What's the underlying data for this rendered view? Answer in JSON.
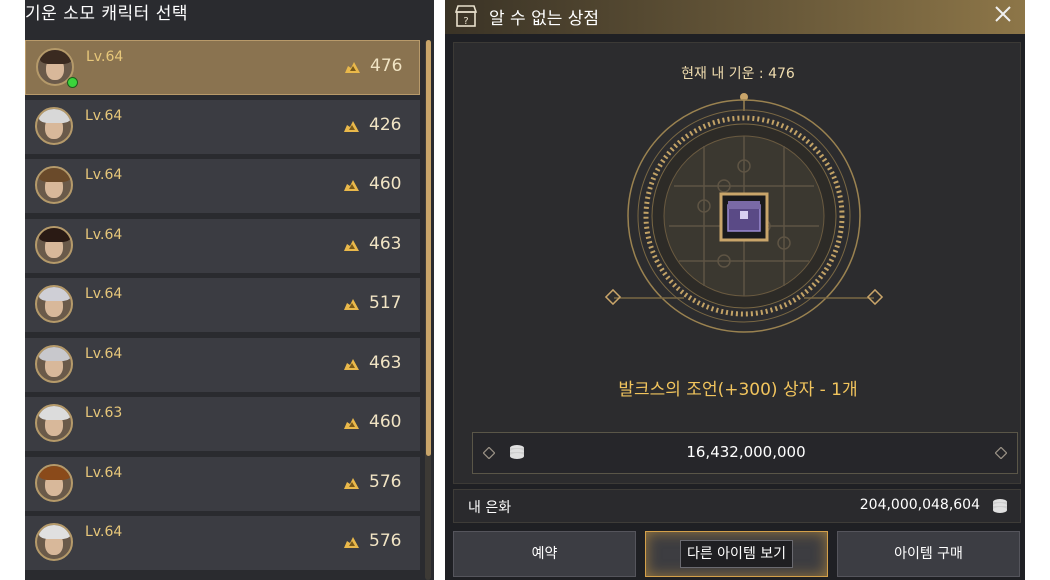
{
  "left_panel": {
    "title": "기운 소모 캐릭터 선택",
    "characters": [
      {
        "level": "Lv.64",
        "points": "476",
        "selected": true,
        "online": true
      },
      {
        "level": "Lv.64",
        "points": "426"
      },
      {
        "level": "Lv.64",
        "points": "460"
      },
      {
        "level": "Lv.64",
        "points": "463"
      },
      {
        "level": "Lv.64",
        "points": "517"
      },
      {
        "level": "Lv.64",
        "points": "463"
      },
      {
        "level": "Lv.63",
        "points": "460"
      },
      {
        "level": "Lv.64",
        "points": "576"
      },
      {
        "level": "Lv.64",
        "points": "576"
      }
    ]
  },
  "shop": {
    "title": "알 수 없는 상점",
    "current_spirit": "현재 내 기운 : 476",
    "item_name": "발크스의 조언(+300) 상자 - 1개",
    "price": "16,432,000,000",
    "balance_label": "내 은화",
    "balance_value": "204,000,048,604",
    "buttons": {
      "reserve": "예약",
      "view_other": "다른 아이템 보기",
      "buy": "아이템 구매"
    }
  },
  "colors": {
    "accent_gold": "#e7c77a",
    "item_gold": "#f1c45d",
    "online_green": "#3bd43b"
  }
}
